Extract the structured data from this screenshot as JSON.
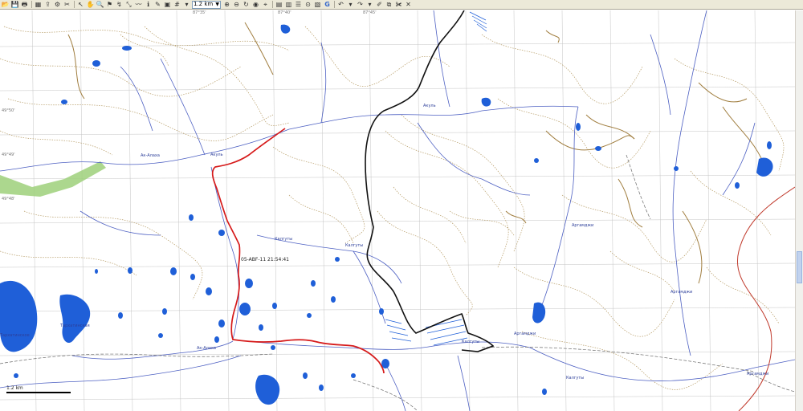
{
  "toolbar": {
    "scale_value": "1.2 km"
  },
  "map": {
    "track_timestamp": "05-ABF-11 21:54:41",
    "scale_bar_label": "1.2 km",
    "river_labels": [
      "Акуль",
      "Акуль",
      "Ак-Алаха",
      "Калгуты",
      "Калгуты",
      "Калгуты",
      "Калгуты",
      "Аргамджи",
      "Аргамджи",
      "Аргамджи",
      "Ак-Алаха",
      "Аргамджи"
    ],
    "lake_labels": [
      "Тархатинское",
      "Тархатинская"
    ],
    "grid_lat_labels": [
      "49°50'",
      "49°49'",
      "49°48'"
    ],
    "grid_lon_labels": [
      "87°35'",
      "87°40'",
      "87°45'"
    ],
    "colors": {
      "water": "#1f5fd8",
      "river": "#4c5fc2",
      "contour": "#a89059",
      "track_red": "#d61a1a",
      "track_black": "#111111",
      "grid": "#b9b9b9",
      "forest": "#9ed07a"
    }
  }
}
